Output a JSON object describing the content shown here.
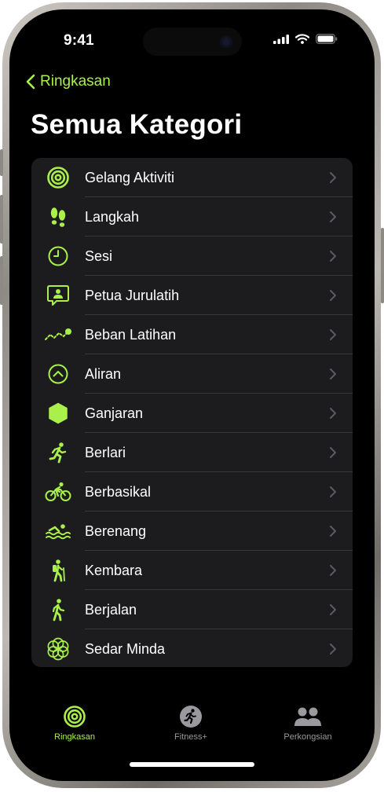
{
  "status": {
    "time": "9:41"
  },
  "nav": {
    "back_label": "Ringkasan"
  },
  "page": {
    "title": "Semua Kategori"
  },
  "categories": [
    {
      "label": "Gelang Aktiviti",
      "icon": "activity-rings-icon"
    },
    {
      "label": "Langkah",
      "icon": "footprints-icon"
    },
    {
      "label": "Sesi",
      "icon": "clock-icon"
    },
    {
      "label": "Petua Jurulatih",
      "icon": "coach-tips-icon"
    },
    {
      "label": "Beban Latihan",
      "icon": "training-load-icon"
    },
    {
      "label": "Aliran",
      "icon": "trends-icon"
    },
    {
      "label": "Ganjaran",
      "icon": "awards-icon"
    },
    {
      "label": "Berlari",
      "icon": "running-icon"
    },
    {
      "label": "Berbasikal",
      "icon": "cycling-icon"
    },
    {
      "label": "Berenang",
      "icon": "swimming-icon"
    },
    {
      "label": "Kembara",
      "icon": "hiking-icon"
    },
    {
      "label": "Berjalan",
      "icon": "walking-icon"
    },
    {
      "label": "Sedar Minda",
      "icon": "mindfulness-icon"
    }
  ],
  "tabs": [
    {
      "label": "Ringkasan",
      "active": true
    },
    {
      "label": "Fitness+",
      "active": false
    },
    {
      "label": "Perkongsian",
      "active": false
    }
  ],
  "colors": {
    "accent": "#a9f04a",
    "background": "#000000",
    "cell": "#1c1c1e",
    "separator": "#38383a",
    "inactive": "#9a9a9e"
  }
}
